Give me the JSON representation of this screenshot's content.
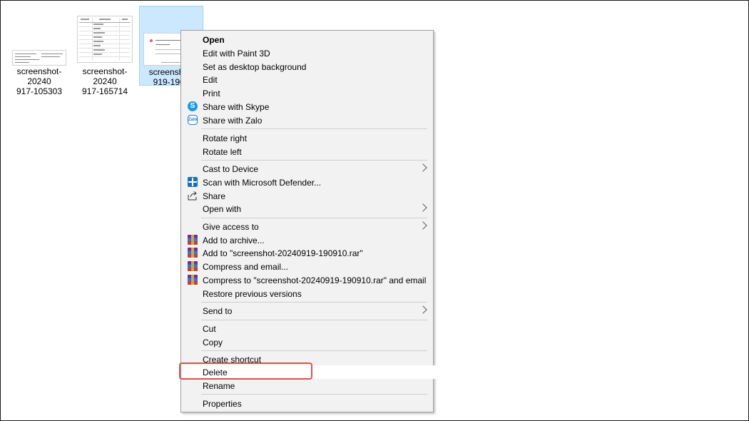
{
  "files": [
    {
      "name_line1": "screenshot-20240",
      "name_line2": "917-105303"
    },
    {
      "name_line1": "screenshot-20240",
      "name_line2": "917-165714"
    },
    {
      "name_line1": "screenshot-",
      "name_line2": "919-1909"
    }
  ],
  "menu": {
    "items": [
      {
        "label": "Open"
      },
      {
        "label": "Edit with Paint 3D"
      },
      {
        "label": "Set as desktop background"
      },
      {
        "label": "Edit"
      },
      {
        "label": "Print"
      },
      {
        "label": "Share with Skype",
        "icon": "skype-icon"
      },
      {
        "label": "Share with Zalo",
        "icon": "zalo-icon"
      },
      {
        "label": "Rotate right"
      },
      {
        "label": "Rotate left"
      },
      {
        "label": "Cast to Device"
      },
      {
        "label": "Scan with Microsoft Defender...",
        "icon": "defender-icon"
      },
      {
        "label": "Share",
        "icon": "share-icon"
      },
      {
        "label": "Open with"
      },
      {
        "label": "Give access to"
      },
      {
        "label": "Add to archive...",
        "icon": "winrar-icon"
      },
      {
        "label": "Add to \"screenshot-20240919-190910.rar\"",
        "icon": "winrar-icon"
      },
      {
        "label": "Compress and email...",
        "icon": "winrar-icon"
      },
      {
        "label": "Compress to \"screenshot-20240919-190910.rar\" and email",
        "icon": "winrar-icon"
      },
      {
        "label": "Restore previous versions"
      },
      {
        "label": "Send to"
      },
      {
        "label": "Cut"
      },
      {
        "label": "Copy"
      },
      {
        "label": "Create shortcut"
      },
      {
        "label": "Delete"
      },
      {
        "label": "Rename"
      },
      {
        "label": "Properties"
      }
    ],
    "icon_text": {
      "skype": "S",
      "zalo": "Zalo"
    }
  },
  "colors": {
    "highlight_border": "#d9534f",
    "selection": "#cce8ff",
    "menu_bg": "#f2f2f2"
  }
}
